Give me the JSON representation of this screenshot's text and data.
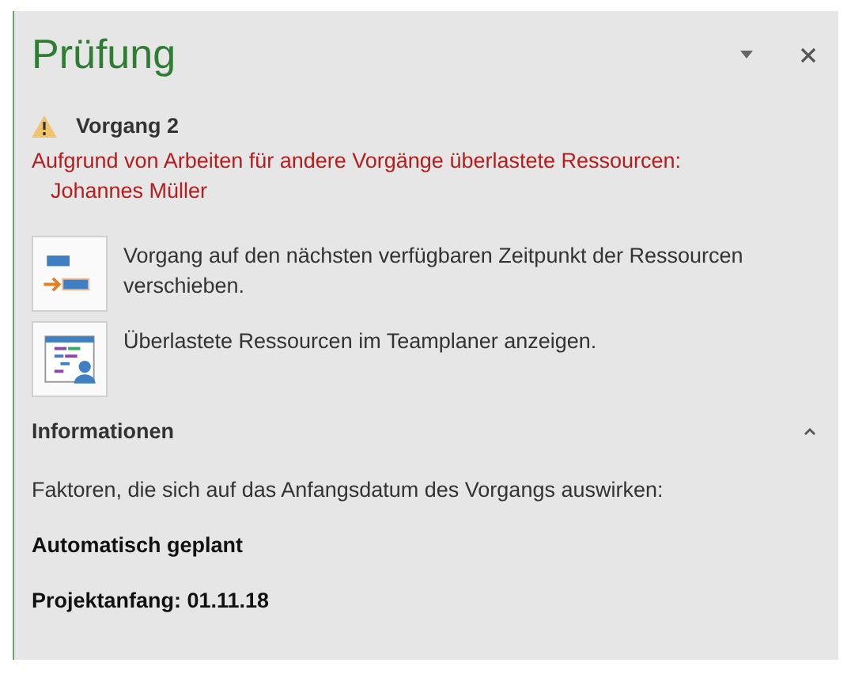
{
  "pane": {
    "title": "Prüfung"
  },
  "issue": {
    "title": "Vorgang 2",
    "message": "Aufgrund von Arbeiten für andere Vorgänge überlastete Ressourcen:",
    "resource": "Johannes Müller"
  },
  "actions": [
    {
      "kind": "move",
      "label": "Vorgang auf den nächsten verfügbaren Zeitpunkt der Ressourcen verschieben."
    },
    {
      "kind": "teamplanner",
      "label": "Überlastete Ressourcen im Teamplaner anzeigen."
    }
  ],
  "info": {
    "title": "Informationen",
    "expanded": true,
    "intro": "Faktoren, die sich auf das Anfangsdatum des Vorgangs auswirken:",
    "factors": [
      "Automatisch geplant",
      "Projektanfang: 01.11.18"
    ]
  }
}
